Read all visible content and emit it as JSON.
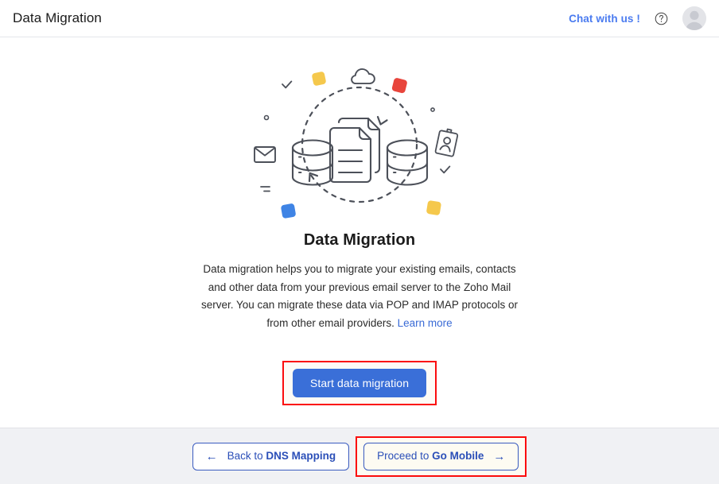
{
  "header": {
    "title": "Data Migration",
    "chat_label": "Chat with us !",
    "help_icon": "question-mark-circle-icon",
    "avatar_icon": "user-avatar-icon"
  },
  "main": {
    "illustration_name": "data-migration-illustration",
    "panel_title": "Data Migration",
    "description_text": "Data migration helps you to migrate your existing emails, contacts and other data from your previous email server to the Zoho Mail server. You can migrate these data via POP and IMAP protocols or from other email providers.",
    "learn_more_label": "Learn more",
    "cta_label": "Start data migration"
  },
  "footer": {
    "back_prefix": "Back to ",
    "back_target": "DNS Mapping",
    "back_arrow": "←",
    "next_prefix": "Proceed to ",
    "next_target": "Go Mobile",
    "next_arrow": "→"
  },
  "colors": {
    "accent_blue": "#3a6fd8",
    "link_blue": "#4a7bf0",
    "nav_blue": "#2b4fb8",
    "annotation_red": "#fb0c0c",
    "footer_bg": "#f0f1f4",
    "illus_stroke": "#4c5059",
    "illus_yellow": "#f5c84c",
    "illus_red": "#e8453c",
    "illus_blue": "#3f84e5"
  }
}
